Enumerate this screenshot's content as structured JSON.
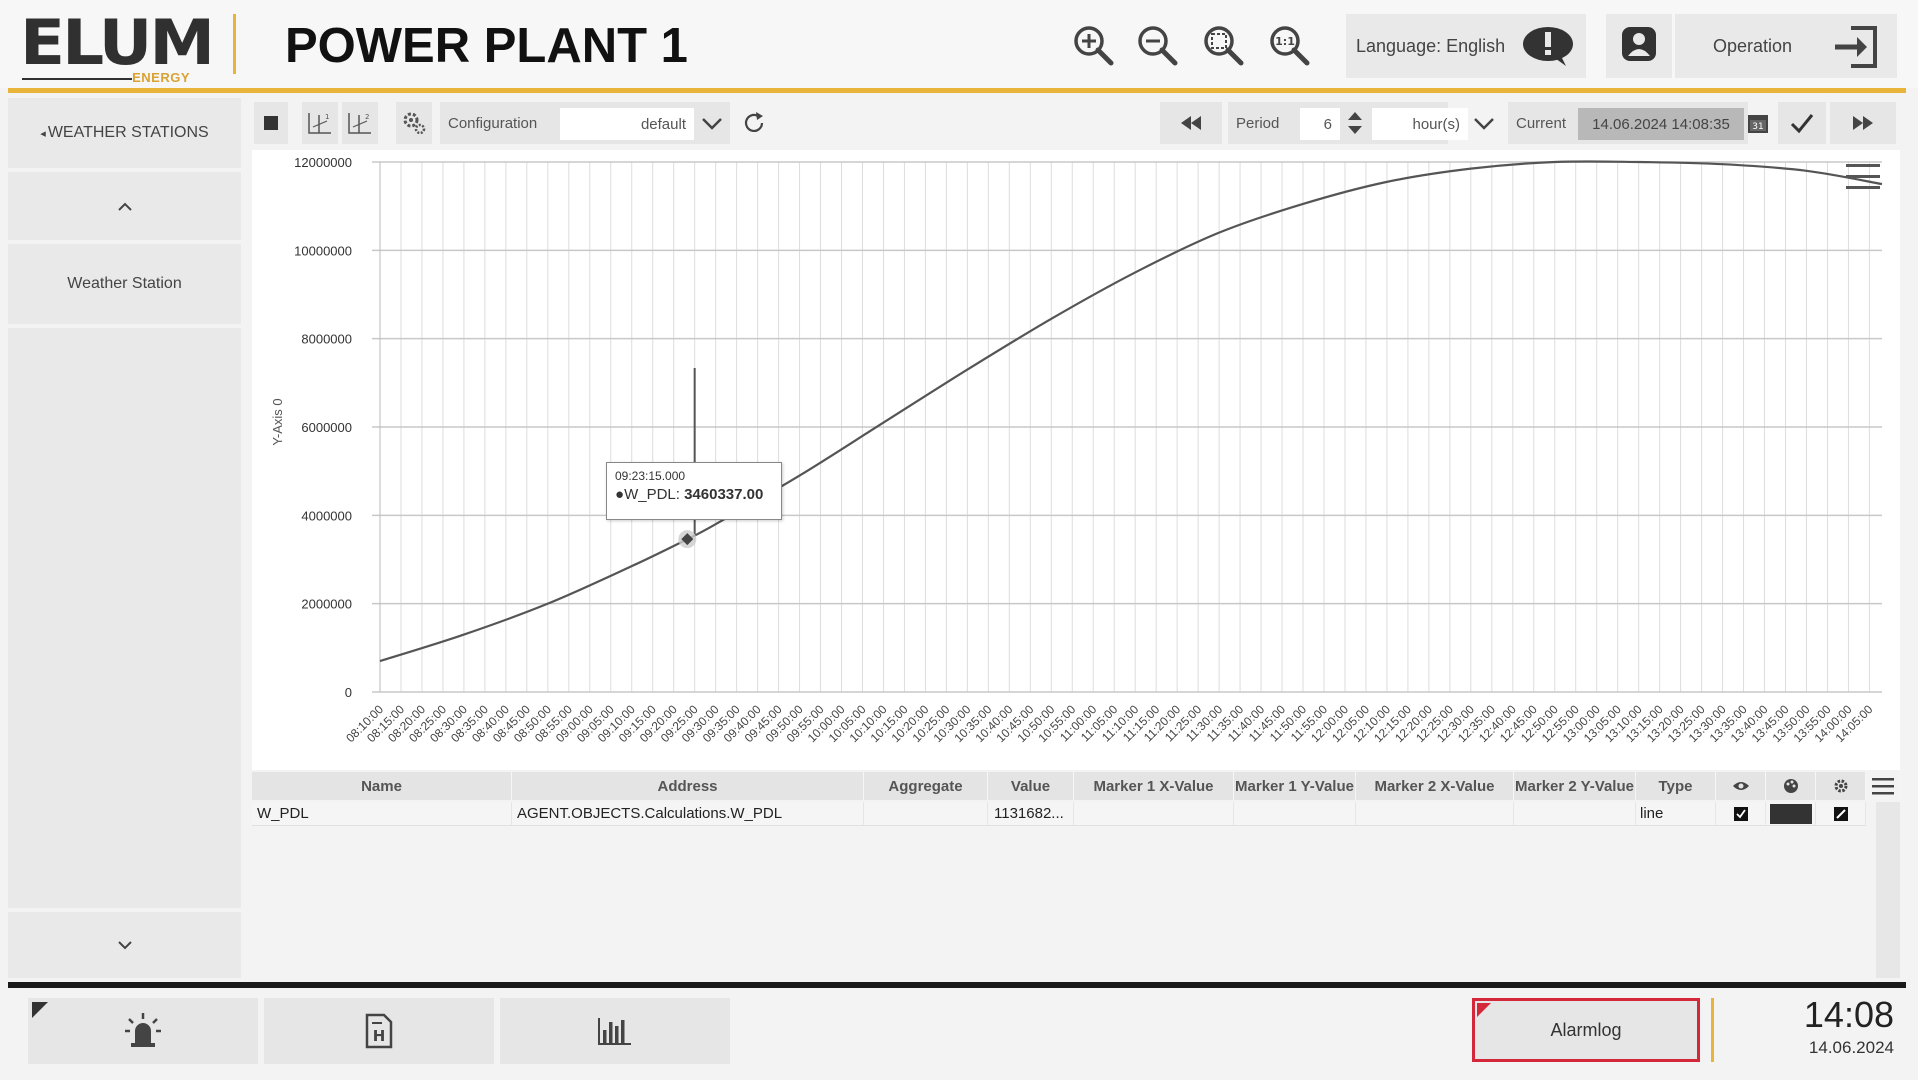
{
  "header": {
    "logo_text": "ELUM",
    "logo_sub": "ENERGY",
    "title": "POWER PLANT 1",
    "language_label": "Language: English",
    "operation_label": "Operation",
    "icons": [
      "zoom-in-icon",
      "zoom-out-icon",
      "zoom-fit-icon",
      "zoom-reset-icon",
      "alert-bubble-icon",
      "user-lock-icon",
      "logout-icon"
    ]
  },
  "sidebar": {
    "back_label": "WEATHER STATIONS",
    "items": [
      {
        "label": "Weather Station"
      }
    ]
  },
  "toolbar": {
    "configuration_label": "Configuration",
    "configuration_value": "default",
    "period_label": "Period",
    "period_value": "6",
    "period_unit": "hour(s)",
    "current_label": "Current",
    "current_value": "14.06.2024 14:08:35",
    "calendar_day": "31"
  },
  "chart_data": {
    "type": "line",
    "ylabel": "Y-Axis 0",
    "xlabel": "",
    "title": "",
    "ylim": [
      0,
      12000000
    ],
    "yticks": [
      "0",
      "2000000",
      "4000000",
      "6000000",
      "8000000",
      "10000000",
      "12000000"
    ],
    "xticks": [
      "08:10:00",
      "08:15:00",
      "08:20:00",
      "08:25:00",
      "08:30:00",
      "08:35:00",
      "08:40:00",
      "08:45:00",
      "08:50:00",
      "08:55:00",
      "09:00:00",
      "09:05:00",
      "09:10:00",
      "09:15:00",
      "09:20:00",
      "09:25:00",
      "09:30:00",
      "09:35:00",
      "09:40:00",
      "09:45:00",
      "09:50:00",
      "09:55:00",
      "10:00:00",
      "10:05:00",
      "10:10:00",
      "10:15:00",
      "10:20:00",
      "10:25:00",
      "10:30:00",
      "10:35:00",
      "10:40:00",
      "10:45:00",
      "10:50:00",
      "10:55:00",
      "11:00:00",
      "11:05:00",
      "11:10:00",
      "11:15:00",
      "11:20:00",
      "11:25:00",
      "11:30:00",
      "11:35:00",
      "11:40:00",
      "11:45:00",
      "11:50:00",
      "11:55:00",
      "12:00:00",
      "12:05:00",
      "12:10:00",
      "12:15:00",
      "12:20:00",
      "12:25:00",
      "12:30:00",
      "12:35:00",
      "12:40:00",
      "12:45:00",
      "12:50:00",
      "12:55:00",
      "13:00:00",
      "13:05:00",
      "13:10:00",
      "13:15:00",
      "13:20:00",
      "13:25:00",
      "13:30:00",
      "13:35:00",
      "13:40:00",
      "13:45:00",
      "13:50:00",
      "13:55:00",
      "14:00:00",
      "14:05:00"
    ],
    "grid": true,
    "series": [
      {
        "name": "W_PDL",
        "color": "#555555",
        "x": [
          "08:10:00",
          "08:30:00",
          "08:50:00",
          "09:10:00",
          "09:23:15",
          "09:30:00",
          "09:50:00",
          "10:10:00",
          "10:30:00",
          "10:50:00",
          "11:10:00",
          "11:30:00",
          "11:50:00",
          "12:10:00",
          "12:30:00",
          "12:50:00",
          "13:10:00",
          "13:30:00",
          "13:50:00",
          "14:08:00"
        ],
        "y": [
          700000,
          1300000,
          2000000,
          2850000,
          3460337,
          3800000,
          4900000,
          6100000,
          7300000,
          8450000,
          9500000,
          10400000,
          11050000,
          11550000,
          11850000,
          12000000,
          12000000,
          11950000,
          11800000,
          11500000
        ]
      }
    ],
    "tooltip": {
      "time": "09:23:15.000",
      "series": "W_PDL",
      "value": "3460337.00"
    }
  },
  "table": {
    "columns": [
      "Name",
      "Address",
      "Aggregate",
      "Value",
      "Marker 1 X-Value",
      "Marker 1 Y-Value",
      "Marker 2 X-Value",
      "Marker 2 Y-Value",
      "Type"
    ],
    "rows": [
      {
        "name": "W_PDL",
        "address": "AGENT.OBJECTS.Calculations.W_PDL",
        "aggregate": "",
        "value": "1131682...",
        "m1x": "",
        "m1y": "",
        "m2x": "",
        "m2y": "",
        "type": "line",
        "visible": true,
        "color": "#333333"
      }
    ]
  },
  "footer": {
    "alarm_label": "Alarmlog",
    "time": "14:08",
    "date": "14.06.2024"
  },
  "colors": {
    "accent": "#e8b43a",
    "alarm": "#d4273a"
  }
}
